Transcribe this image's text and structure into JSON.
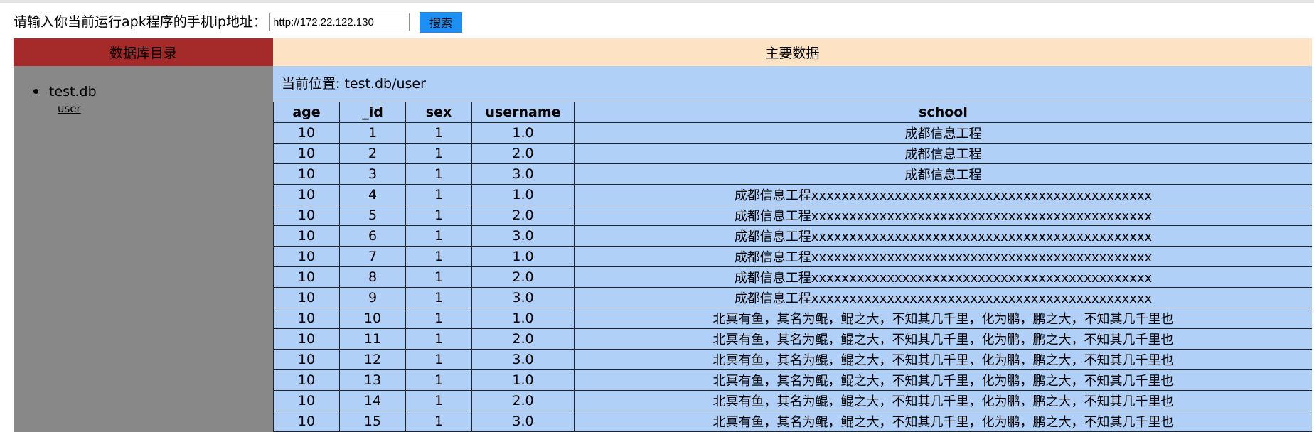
{
  "search": {
    "prompt": "请输入你当前运行apk程序的手机ip地址：",
    "value": "http://172.22.122.130",
    "button_label": "搜索"
  },
  "sidebar": {
    "title": "数据库目录",
    "databases": [
      {
        "name": "test.db",
        "tables": [
          "user"
        ]
      }
    ]
  },
  "main": {
    "title": "主要数据",
    "location_label": "当前位置: test.db/user",
    "columns": [
      "age",
      "_id",
      "sex",
      "username",
      "school"
    ],
    "rows": [
      [
        "10",
        "1",
        "1",
        "1.0",
        "成都信息工程"
      ],
      [
        "10",
        "2",
        "1",
        "2.0",
        "成都信息工程"
      ],
      [
        "10",
        "3",
        "1",
        "3.0",
        "成都信息工程"
      ],
      [
        "10",
        "4",
        "1",
        "1.0",
        "成都信息工程xxxxxxxxxxxxxxxxxxxxxxxxxxxxxxxxxxxxxxxxxxxxx"
      ],
      [
        "10",
        "5",
        "1",
        "2.0",
        "成都信息工程xxxxxxxxxxxxxxxxxxxxxxxxxxxxxxxxxxxxxxxxxxxxx"
      ],
      [
        "10",
        "6",
        "1",
        "3.0",
        "成都信息工程xxxxxxxxxxxxxxxxxxxxxxxxxxxxxxxxxxxxxxxxxxxxx"
      ],
      [
        "10",
        "7",
        "1",
        "1.0",
        "成都信息工程xxxxxxxxxxxxxxxxxxxxxxxxxxxxxxxxxxxxxxxxxxxxx"
      ],
      [
        "10",
        "8",
        "1",
        "2.0",
        "成都信息工程xxxxxxxxxxxxxxxxxxxxxxxxxxxxxxxxxxxxxxxxxxxxx"
      ],
      [
        "10",
        "9",
        "1",
        "3.0",
        "成都信息工程xxxxxxxxxxxxxxxxxxxxxxxxxxxxxxxxxxxxxxxxxxxxx"
      ],
      [
        "10",
        "10",
        "1",
        "1.0",
        "北冥有鱼，其名为鲲，鲲之大，不知其几千里，化为鹏，鹏之大，不知其几千里也"
      ],
      [
        "10",
        "11",
        "1",
        "2.0",
        "北冥有鱼，其名为鲲，鲲之大，不知其几千里，化为鹏，鹏之大，不知其几千里也"
      ],
      [
        "10",
        "12",
        "1",
        "3.0",
        "北冥有鱼，其名为鲲，鲲之大，不知其几千里，化为鹏，鹏之大，不知其几千里也"
      ],
      [
        "10",
        "13",
        "1",
        "1.0",
        "北冥有鱼，其名为鲲，鲲之大，不知其几千里，化为鹏，鹏之大，不知其几千里也"
      ],
      [
        "10",
        "14",
        "1",
        "2.0",
        "北冥有鱼，其名为鲲，鲲之大，不知其几千里，化为鹏，鹏之大，不知其几千里也"
      ],
      [
        "10",
        "15",
        "1",
        "3.0",
        "北冥有鱼，其名为鲲，鲲之大，不知其几千里，化为鹏，鹏之大，不知其几千里也"
      ]
    ]
  },
  "colors": {
    "sidebar_header": "#a52a2a",
    "sidebar_bg": "#888888",
    "main_header": "#fde3c4",
    "main_bg": "#b0d0f8",
    "button": "#1c90f3"
  }
}
